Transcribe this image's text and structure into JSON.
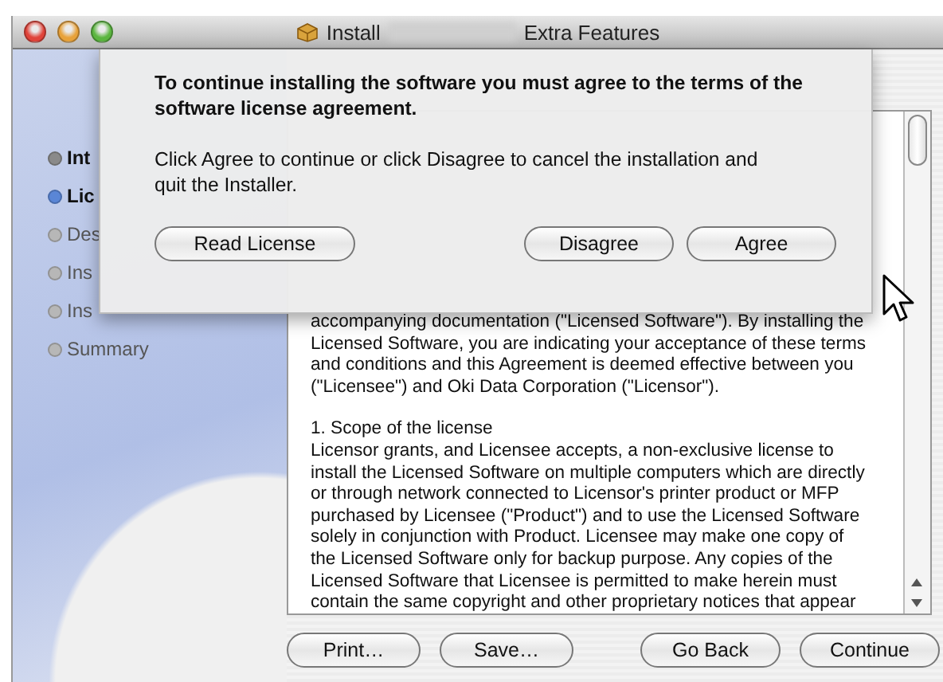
{
  "window": {
    "title_start": "Install",
    "title_end": "Extra Features"
  },
  "sidebar": {
    "items": [
      {
        "label": "Int",
        "selected": false,
        "completed": true
      },
      {
        "label": "Lic",
        "selected": true,
        "completed": false
      },
      {
        "label": "Des",
        "selected": false,
        "completed": false
      },
      {
        "label": "Ins",
        "selected": false,
        "completed": false
      },
      {
        "label": "Ins",
        "selected": false,
        "completed": false
      },
      {
        "label": "Summary",
        "selected": false,
        "completed": false
      }
    ]
  },
  "license_text": {
    "paragraphs": [
      [
        "accompanying documentation (\"Licensed Software\"). By installing the",
        "Licensed Software, you are indicating your acceptance of these terms",
        "and conditions and this Agreement is deemed effective between you",
        "(\"Licensee\") and Oki Data Corporation (\"Licensor\")."
      ],
      [
        "1.  Scope of the license",
        "Licensor grants, and Licensee accepts, a non-exclusive license to",
        "install the Licensed Software on multiple computers which are directly",
        "or through network connected to Licensor's printer product or MFP",
        "purchased by Licensee (\"Product\") and to use the Licensed Software",
        "solely in conjunction with Product. Licensee may make one copy of",
        "the Licensed Software only for backup purpose. Any copies of the",
        "Licensed Software that Licensee is permitted to make herein must",
        "contain the same copyright and other proprietary notices that appear"
      ]
    ]
  },
  "footer_buttons": {
    "left": [
      "Print…",
      "Save…"
    ],
    "right": [
      "Go Back",
      "Continue"
    ]
  },
  "sheet": {
    "heading": "To continue installing the software you must agree to the terms of the software license agreement.",
    "message": "Click Agree to continue or click Disagree to cancel the installation and quit the Installer.",
    "left_button": "Read License",
    "right_buttons": [
      "Disagree",
      "Agree"
    ]
  }
}
